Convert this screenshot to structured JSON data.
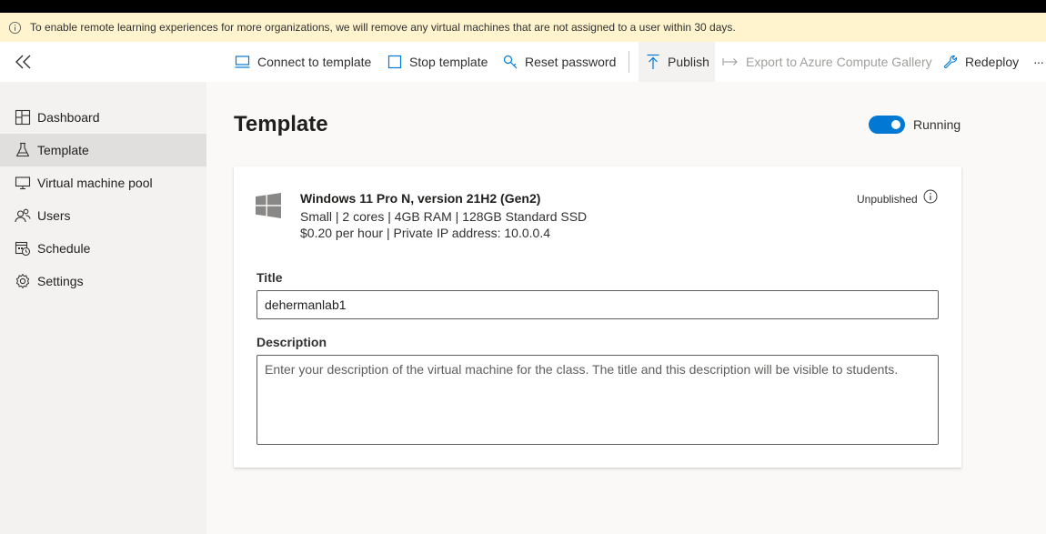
{
  "banner": {
    "icon": "info-icon",
    "text": "To enable remote learning experiences for more organizations, we will remove any virtual machines that are not assigned to a user within 30 days."
  },
  "commandbar": {
    "collapse_icon": "double-chevron-left-icon",
    "connect_label": "Connect to template",
    "stop_label": "Stop template",
    "reset_label": "Reset password",
    "publish_label": "Publish",
    "export_label": "Export to Azure Compute Gallery",
    "redeploy_label": "Redeploy",
    "more_label": "···"
  },
  "sidebar": {
    "items": [
      {
        "label": "Dashboard",
        "icon": "dashboard-icon"
      },
      {
        "label": "Template",
        "icon": "flask-icon"
      },
      {
        "label": "Virtual machine pool",
        "icon": "monitor-icon"
      },
      {
        "label": "Users",
        "icon": "users-icon"
      },
      {
        "label": "Schedule",
        "icon": "calendar-icon"
      },
      {
        "label": "Settings",
        "icon": "gear-icon"
      }
    ],
    "selected": "Template"
  },
  "main": {
    "title": "Template",
    "toggle_label": "Running",
    "toggle_on": true
  },
  "vm": {
    "os_icon": "windows-icon",
    "name": "Windows 11 Pro N, version 21H2 (Gen2)",
    "spec": "Small | 2 cores | 4GB RAM | 128GB Standard SSD",
    "price": "$0.20 per hour | Private IP address: 10.0.0.4",
    "publish_status": "Unpublished"
  },
  "form": {
    "title_label": "Title",
    "title_value": "dehermanlab1",
    "description_label": "Description",
    "description_placeholder": "Enter your description of the virtual machine for the class. The title and this description will be visible to students."
  },
  "colors": {
    "accent": "#0078d4",
    "banner_bg": "#fff4ce",
    "sidebar_bg": "#f3f2f1",
    "selected_bg": "#e1dfdd"
  }
}
